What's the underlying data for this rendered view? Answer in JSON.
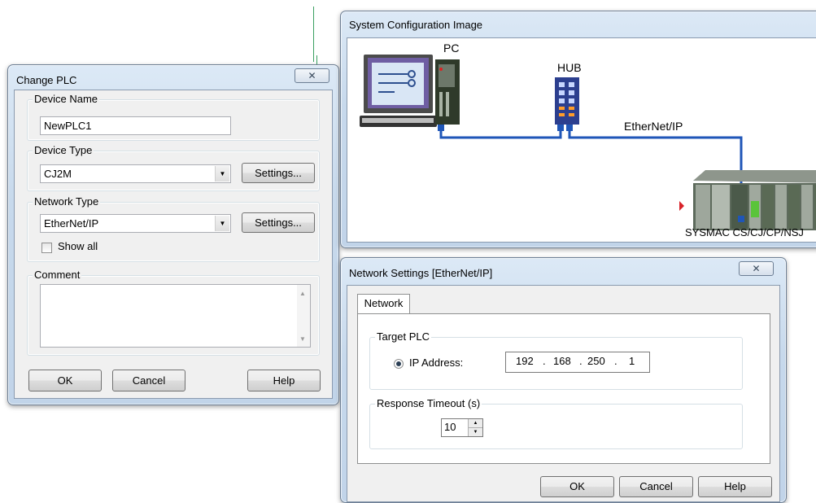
{
  "change_plc": {
    "title": "Change PLC",
    "close_glyph": "✕",
    "device_name": {
      "label": "Device Name",
      "value": "NewPLC1"
    },
    "device_type": {
      "label": "Device Type",
      "value": "CJ2M",
      "settings_label": "Settings..."
    },
    "network_type": {
      "label": "Network Type",
      "value": "EtherNet/IP",
      "settings_label": "Settings...",
      "show_all_label": "Show all",
      "show_all_checked": false
    },
    "comment": {
      "label": "Comment",
      "value": ""
    },
    "buttons": {
      "ok": "OK",
      "cancel": "Cancel",
      "help": "Help"
    }
  },
  "system_config": {
    "title": "System Configuration Image",
    "pc_label": "PC",
    "hub_label": "HUB",
    "network_label": "EtherNet/IP",
    "plc_label": "SYSMAC CS/CJ/CP/NSJ",
    "cable_color": "#1f56b8"
  },
  "network_settings": {
    "title": "Network Settings [EtherNet/IP]",
    "close_glyph": "✕",
    "tab_label": "Network",
    "target_plc": {
      "label": "Target PLC",
      "ip_label": "IP Address:",
      "ip_octets": [
        "192",
        "168",
        "250",
        "1"
      ]
    },
    "response_timeout": {
      "label": "Response Timeout (s)",
      "value": "10"
    },
    "buttons": {
      "ok": "OK",
      "cancel": "Cancel",
      "help": "Help"
    }
  }
}
